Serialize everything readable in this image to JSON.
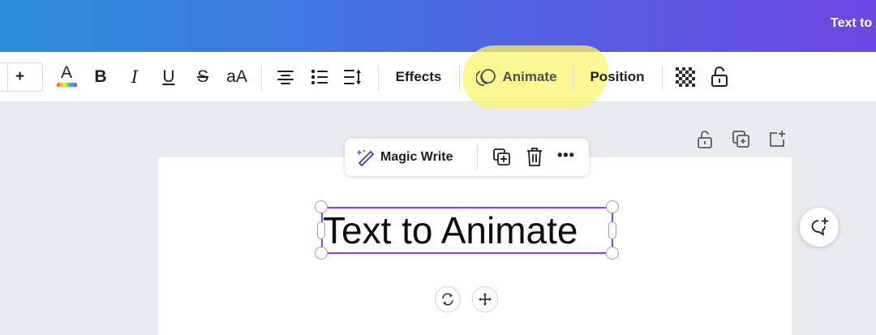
{
  "header": {
    "title": "Text to Animate"
  },
  "toolbar": {
    "font_size_increase": "+",
    "text_color_letter": "A",
    "bold_label": "B",
    "italic_label": "I",
    "underline_label": "U",
    "strikethrough_label": "S",
    "letter_case_label": "aA",
    "effects_label": "Effects",
    "animate_label": "Animate",
    "position_label": "Position"
  },
  "context_toolbar": {
    "magic_write_label": "Magic Write",
    "more_label": "•••"
  },
  "canvas": {
    "text_element": "Text to Animate"
  },
  "colors": {
    "header_gradient_start": "#2d8fd8",
    "header_gradient_end": "#6b48e2",
    "selection": "#8b3dff",
    "highlight": "#faf46e"
  }
}
